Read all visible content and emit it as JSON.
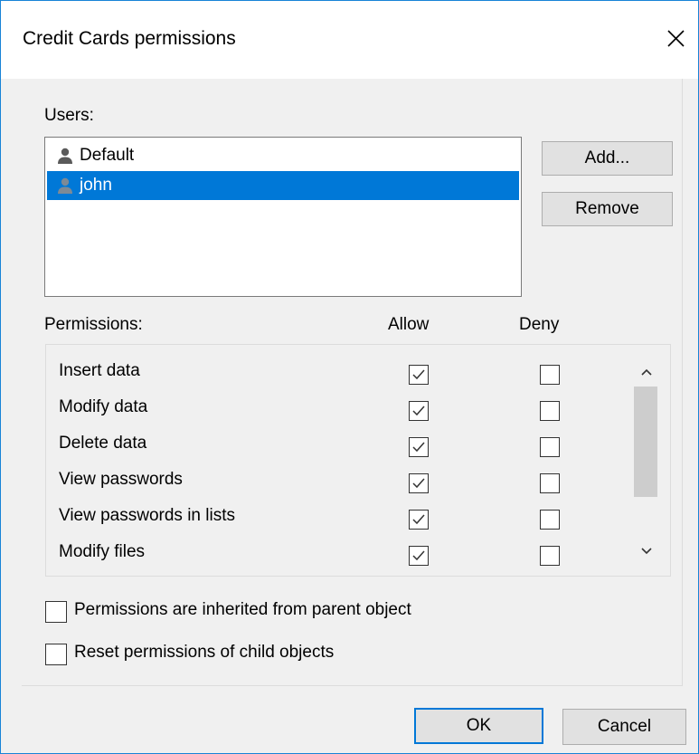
{
  "window": {
    "title": "Credit Cards permissions"
  },
  "users": {
    "label": "Users:",
    "items": [
      {
        "name": "Default",
        "selected": false
      },
      {
        "name": "john",
        "selected": true
      }
    ],
    "add_label": "Add...",
    "remove_label": "Remove"
  },
  "permissions": {
    "label": "Permissions:",
    "allow_header": "Allow",
    "deny_header": "Deny",
    "rows": [
      {
        "name": "Insert data",
        "allow": true,
        "deny": false
      },
      {
        "name": "Modify data",
        "allow": true,
        "deny": false
      },
      {
        "name": "Delete data",
        "allow": true,
        "deny": false
      },
      {
        "name": "View passwords",
        "allow": true,
        "deny": false
      },
      {
        "name": "View passwords in lists",
        "allow": true,
        "deny": false
      },
      {
        "name": "Modify files",
        "allow": true,
        "deny": false
      }
    ]
  },
  "options": {
    "inherit_label": "Permissions are inherited from parent object",
    "inherit_checked": false,
    "reset_label": "Reset permissions of child objects",
    "reset_checked": false
  },
  "footer": {
    "ok_label": "OK",
    "cancel_label": "Cancel"
  },
  "colors": {
    "accent": "#0078d7",
    "selection": "#0078d7"
  }
}
